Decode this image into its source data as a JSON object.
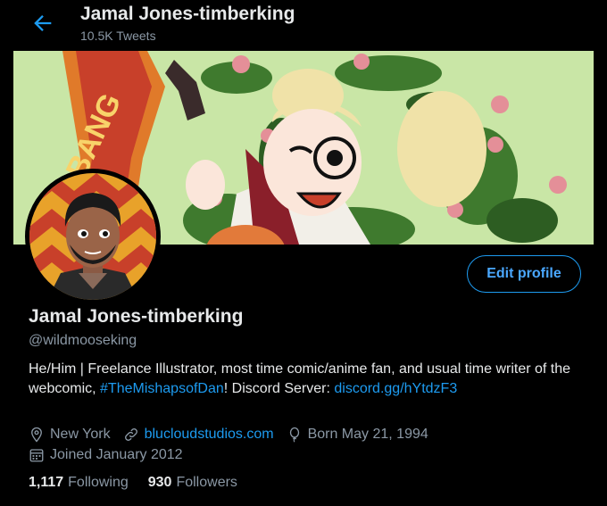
{
  "header": {
    "title": "Jamal Jones-timberking",
    "tweet_count": "10.5K Tweets"
  },
  "profile": {
    "name": "Jamal Jones-timberking",
    "handle": "@wildmooseking",
    "edit_label": "Edit profile",
    "bio": {
      "part1": "He/Him | Freelance Illustrator, most time comic/anime fan, and usual time writer of the webcomic, ",
      "hashtag": "#TheMishapsofDan",
      "part2": "! Discord Server: ",
      "link": "discord.gg/hYtdzF3"
    },
    "location": "New York",
    "website": "blucloudstudios.com",
    "birthday": "Born May 21, 1994",
    "joined": "Joined January 2012",
    "following_count": "1,117",
    "following_label": "Following",
    "followers_count": "930",
    "followers_label": "Followers"
  },
  "banner": {
    "sign_text": "BANG"
  },
  "colors": {
    "accent": "#1d9bf0",
    "background": "#000000",
    "secondary_text": "#8b98a5"
  },
  "icons": [
    "back-arrow-icon",
    "location-pin-icon",
    "link-icon",
    "balloon-icon",
    "calendar-icon"
  ]
}
